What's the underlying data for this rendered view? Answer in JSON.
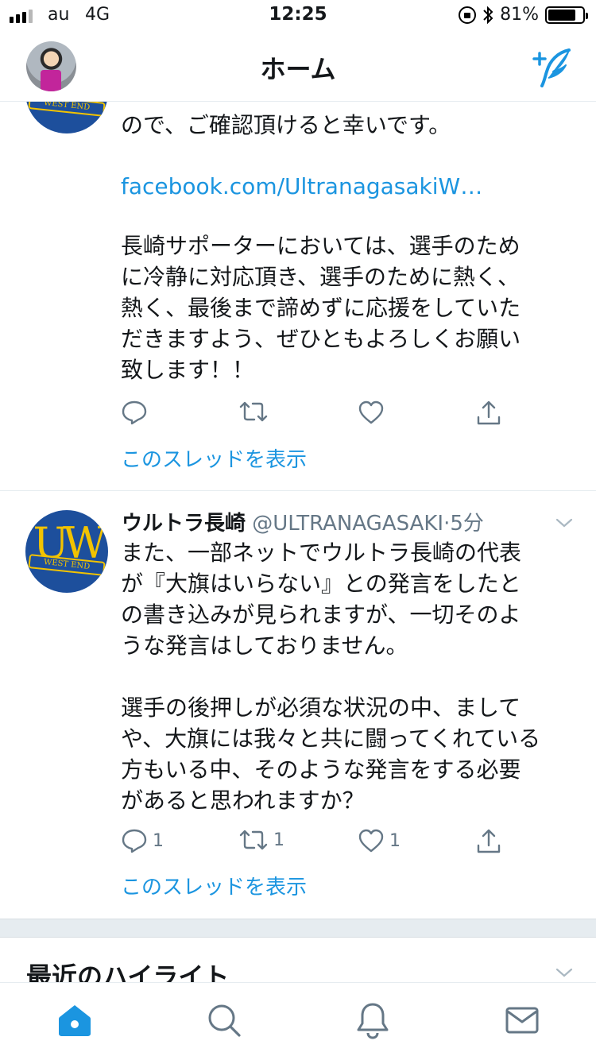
{
  "status_bar": {
    "carrier": "au",
    "network": "4G",
    "time": "12:25",
    "battery": "81%",
    "battery_level": 0.81
  },
  "header": {
    "title": "ホーム"
  },
  "tweets": [
    {
      "text_lines": "ので、ご確認頂けると幸いです。",
      "link": "facebook.com/UltranagasakiW…",
      "text2": "長崎サポーターにおいては、選手のため\nに冷静に対応頂き、選手のために熱く、\n熱く、最後まで諦めずに応援をしていた\nだきますよう、ぜひともよろしくお願い\n致します！！",
      "thread_label": "このスレッドを表示",
      "logo_band": "WEST END"
    },
    {
      "author_name": "ウルトラ長崎",
      "handle": "@ULTRANAGASAKI",
      "dot": "·",
      "time": "5分",
      "text": "また、一部ネットでウルトラ長崎の代表\nが『大旗はいらない』との発言をしたと\nの書き込みが見られますが、一切そのよ\nうな発言はしておりません。\n\n選手の後押しが必須な状況の中、まして\nや、大旗には我々と共に闘ってくれている\n方もいる中、そのような発言をする必要\nがあると思われますか？",
      "reply_count": "1",
      "retweet_count": "1",
      "like_count": "1",
      "thread_label": "このスレッドを表示",
      "logo_band": "WEST END"
    }
  ],
  "highlights": {
    "title": "最近のハイライト"
  },
  "colors": {
    "accent": "#1b95e0",
    "icon_gray": "#657786",
    "logo_blue": "#1d4f9c",
    "logo_gold": "#f2c300"
  },
  "icons": {
    "compose": "compose-tweet-icon",
    "reply": "reply-icon",
    "retweet": "retweet-icon",
    "like": "heart-icon",
    "share": "share-icon",
    "home": "home-icon",
    "search": "search-icon",
    "notifications": "bell-icon",
    "messages": "envelope-icon"
  }
}
